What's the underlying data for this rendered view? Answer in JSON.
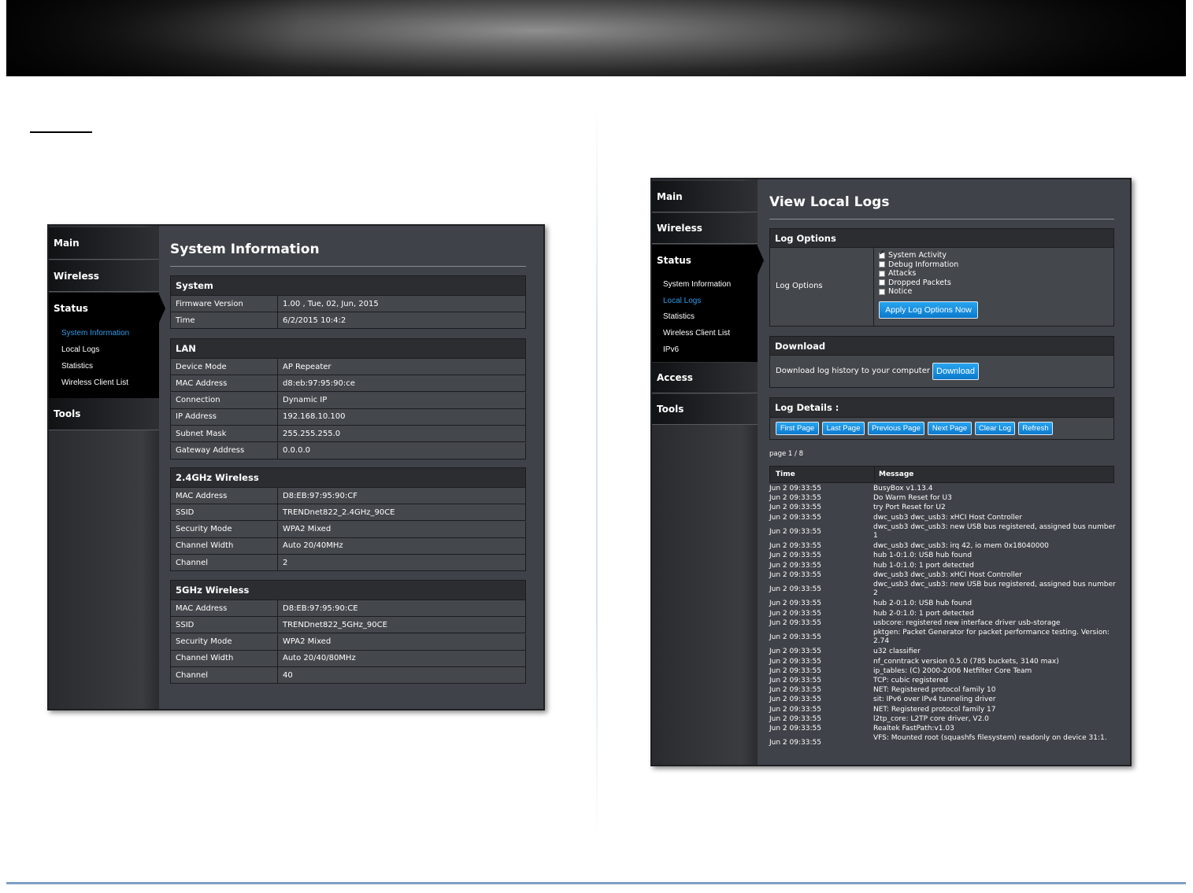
{
  "left_panel": {
    "sidebar": {
      "main": "Main",
      "wireless": "Wireless",
      "status": "Status",
      "status_items": [
        "System Information",
        "Local Logs",
        "Statistics",
        "Wireless Client List"
      ],
      "tools": "Tools"
    },
    "title": "System Information",
    "sections": [
      {
        "title": "System",
        "rows": [
          {
            "k": "Firmware Version",
            "v": "1.00 , Tue, 02, Jun, 2015"
          },
          {
            "k": "Time",
            "v": "6/2/2015 10:4:2"
          }
        ]
      },
      {
        "title": "LAN",
        "rows": [
          {
            "k": "Device Mode",
            "v": "AP Repeater"
          },
          {
            "k": "MAC Address",
            "v": "d8:eb:97:95:90:ce"
          },
          {
            "k": "Connection",
            "v": "Dynamic IP"
          },
          {
            "k": "IP Address",
            "v": "192.168.10.100"
          },
          {
            "k": "Subnet Mask",
            "v": "255.255.255.0"
          },
          {
            "k": "Gateway Address",
            "v": "0.0.0.0"
          }
        ]
      },
      {
        "title": "2.4GHz Wireless",
        "rows": [
          {
            "k": "MAC Address",
            "v": "D8:EB:97:95:90:CF"
          },
          {
            "k": "SSID",
            "v": "TRENDnet822_2.4GHz_90CE"
          },
          {
            "k": "Security Mode",
            "v": "WPA2 Mixed"
          },
          {
            "k": "Channel Width",
            "v": "Auto 20/40MHz"
          },
          {
            "k": "Channel",
            "v": "2"
          }
        ]
      },
      {
        "title": "5GHz Wireless",
        "rows": [
          {
            "k": "MAC Address",
            "v": "D8:EB:97:95:90:CE"
          },
          {
            "k": "SSID",
            "v": "TRENDnet822_5GHz_90CE"
          },
          {
            "k": "Security Mode",
            "v": "WPA2 Mixed"
          },
          {
            "k": "Channel Width",
            "v": "Auto 20/40/80MHz"
          },
          {
            "k": "Channel",
            "v": "40"
          }
        ]
      }
    ]
  },
  "right_panel": {
    "sidebar": {
      "main": "Main",
      "wireless": "Wireless",
      "status": "Status",
      "status_items": [
        "System Information",
        "Local Logs",
        "Statistics",
        "Wireless Client List",
        "IPv6"
      ],
      "access": "Access",
      "tools": "Tools"
    },
    "title": "View Local Logs",
    "log_options": {
      "header": "Log Options",
      "label": "Log Options",
      "checkboxes": [
        {
          "label": "System Activity",
          "checked": true
        },
        {
          "label": "Debug Information",
          "checked": false
        },
        {
          "label": "Attacks",
          "checked": false
        },
        {
          "label": "Dropped Packets",
          "checked": false
        },
        {
          "label": "Notice",
          "checked": false
        }
      ],
      "apply_button": "Apply Log Options Now"
    },
    "download": {
      "header": "Download",
      "text": "Download log history to your computer",
      "button": "Download"
    },
    "log_details": {
      "header": "Log Details :",
      "buttons": [
        "First Page",
        "Last Page",
        "Previous Page",
        "Next Page",
        "Clear Log",
        "Refresh"
      ],
      "page_info": "page 1 / 8",
      "col_time": "Time",
      "col_message": "Message",
      "rows": [
        {
          "t": "Jun 2 09:33:55",
          "m": "BusyBox v1.13.4"
        },
        {
          "t": "Jun 2 09:33:55",
          "m": "Do Warm Reset for U3"
        },
        {
          "t": "Jun 2 09:33:55",
          "m": "try Port Reset for U2"
        },
        {
          "t": "Jun 2 09:33:55",
          "m": "dwc_usb3 dwc_usb3: xHCI Host Controller"
        },
        {
          "t": "Jun 2 09:33:55",
          "m": "dwc_usb3 dwc_usb3: new USB bus registered, assigned bus number 1"
        },
        {
          "t": "Jun 2 09:33:55",
          "m": "dwc_usb3 dwc_usb3: irq 42, io mem 0x18040000"
        },
        {
          "t": "Jun 2 09:33:55",
          "m": "hub 1-0:1.0: USB hub found"
        },
        {
          "t": "Jun 2 09:33:55",
          "m": "hub 1-0:1.0: 1 port detected"
        },
        {
          "t": "Jun 2 09:33:55",
          "m": "dwc_usb3 dwc_usb3: xHCI Host Controller"
        },
        {
          "t": "Jun 2 09:33:55",
          "m": "dwc_usb3 dwc_usb3: new USB bus registered, assigned bus number 2"
        },
        {
          "t": "Jun 2 09:33:55",
          "m": "hub 2-0:1.0: USB hub found"
        },
        {
          "t": "Jun 2 09:33:55",
          "m": "hub 2-0:1.0: 1 port detected"
        },
        {
          "t": "Jun 2 09:33:55",
          "m": "usbcore: registered new interface driver usb-storage"
        },
        {
          "t": "Jun 2 09:33:55",
          "m": "pktgen: Packet Generator for packet performance testing. Version: 2.74"
        },
        {
          "t": "Jun 2 09:33:55",
          "m": "u32 classifier"
        },
        {
          "t": "Jun 2 09:33:55",
          "m": "nf_conntrack version 0.5.0 (785 buckets, 3140 max)"
        },
        {
          "t": "Jun 2 09:33:55",
          "m": "ip_tables: (C) 2000-2006 Netfilter Core Team"
        },
        {
          "t": "Jun 2 09:33:55",
          "m": "TCP: cubic registered"
        },
        {
          "t": "Jun 2 09:33:55",
          "m": "NET: Registered protocol family 10"
        },
        {
          "t": "Jun 2 09:33:55",
          "m": "sit: IPv6 over IPv4 tunneling driver"
        },
        {
          "t": "Jun 2 09:33:55",
          "m": "NET: Registered protocol family 17"
        },
        {
          "t": "Jun 2 09:33:55",
          "m": "l2tp_core: L2TP core driver, V2.0"
        },
        {
          "t": "Jun 2 09:33:55",
          "m": "Realtek FastPath:v1.03"
        },
        {
          "t": "Jun 2 09:33:55",
          "m": "VFS: Mounted root (squashfs filesystem) readonly on device 31:1."
        }
      ]
    }
  }
}
